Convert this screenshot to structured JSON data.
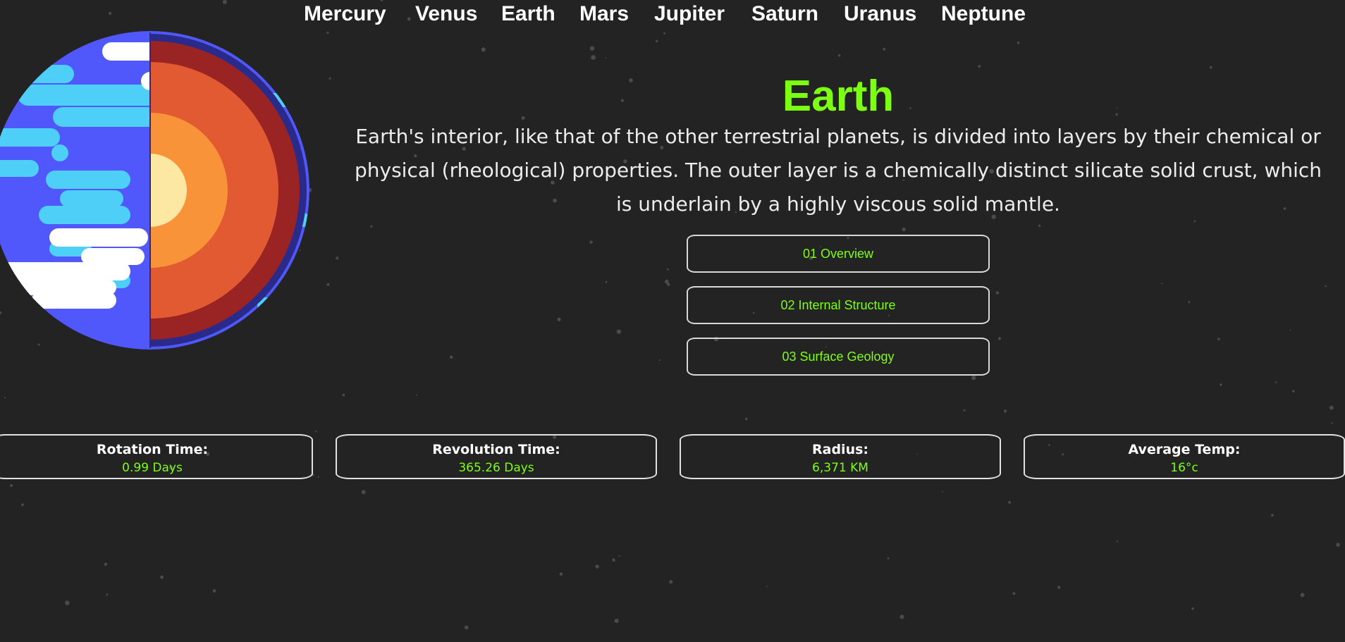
{
  "nav": {
    "items": [
      {
        "label": "Mercury"
      },
      {
        "label": "Venus"
      },
      {
        "label": "Earth"
      },
      {
        "label": "Mars"
      },
      {
        "label": "Jupiter"
      },
      {
        "label": "Saturn"
      },
      {
        "label": "Uranus"
      },
      {
        "label": "Neptune"
      }
    ]
  },
  "planet": {
    "name": "Earth",
    "description": "Earth's interior, like that of the other terrestrial planets, is divided into layers by their chemical or physical (rheological) properties. The outer layer is a chemically distinct silicate solid crust, which is underlain by a highly viscous solid mantle.",
    "image_icon": "earth-internal-structure-icon"
  },
  "tabs": [
    {
      "label": "01 Overview"
    },
    {
      "label": "02 Internal Structure"
    },
    {
      "label": "03 Surface Geology"
    }
  ],
  "stats": [
    {
      "label": "Rotation Time:",
      "value": "0.99 Days"
    },
    {
      "label": "Revolution Time:",
      "value": "365.26 Days"
    },
    {
      "label": "Radius:",
      "value": "6,371 KM"
    },
    {
      "label": "Average Temp:",
      "value": "16°c"
    }
  ],
  "colors": {
    "background": "#232323",
    "accent": "#7cff12",
    "text": "#ffffff",
    "ocean": "#5158fb",
    "cloud_blue": "#4ecff8",
    "crust": "#9a2424",
    "mantle": "#e25a31",
    "outer_core": "#f9933a",
    "inner_core": "#fde8a3"
  }
}
